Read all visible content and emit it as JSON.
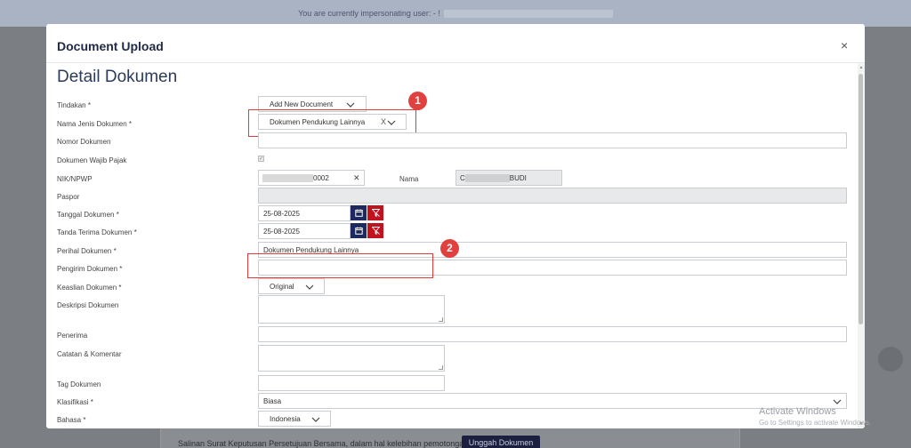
{
  "banner": {
    "text": "You are currently impersonating user: - !"
  },
  "modal": {
    "title": "Document Upload",
    "close_icon": "×",
    "section_title": "Detail Dokumen"
  },
  "form": {
    "tindakan": {
      "label": "Tindakan *",
      "value": "Add New Document"
    },
    "nama_jenis": {
      "label": "Nama Jenis Dokumen *",
      "value": "Dokumen Pendukung Lainnya",
      "clear": "X"
    },
    "nomor": {
      "label": "Nomor Dokumen",
      "value": ""
    },
    "wajib_pajak": {
      "label": "Dokumen Wajib Pajak",
      "checked": true
    },
    "nik": {
      "label": "NIK/NPWP",
      "value_suffix": "0002",
      "clear": "✕",
      "nama_label": "Nama",
      "nama_prefix": "C",
      "nama_suffix": "BUDI"
    },
    "paspor": {
      "label": "Paspor",
      "value": ""
    },
    "tanggal": {
      "label": "Tanggal Dokumen *",
      "value": "25-08-2025"
    },
    "tanda_terima": {
      "label": "Tanda Terima Dokumen *",
      "value": "25-08-2025"
    },
    "perihal": {
      "label": "Perihal Dokumen *",
      "value": "Dokumen Pendukung Lainnya"
    },
    "pengirim": {
      "label": "Pengirim Dokumen *",
      "value": ""
    },
    "keaslian": {
      "label": "Keaslian Dokumen *",
      "value": "Original"
    },
    "deskripsi": {
      "label": "Deskripsi Dokumen"
    },
    "penerima": {
      "label": "Penerima",
      "value": ""
    },
    "catatan": {
      "label": "Catatan & Komentar"
    },
    "tag": {
      "label": "Tag Dokumen",
      "value": ""
    },
    "klasifikasi": {
      "label": "Klasifikasi *",
      "value": "Biasa"
    },
    "bahasa": {
      "label": "Bahasa *",
      "value": "Indonesia"
    }
  },
  "annotations": {
    "badge1": "1",
    "badge2": "2"
  },
  "background": {
    "bottom_text": "Salinan Surat Keputusan Persetujuan Bersama, dalam hal kelebihan pemotongan",
    "upload_button": "Unggah Dokumen"
  },
  "watermark": {
    "line1": "Activate Windows",
    "line2": "Go to Settings to activate Windows."
  },
  "colors": {
    "primary": "#1e2a5e",
    "danger": "#c1121f",
    "annotation": "#e03a3a"
  },
  "icons": {
    "calendar": "calendar-icon",
    "clear_date": "filter-clear-icon",
    "chevron": "chevron-down-icon"
  }
}
